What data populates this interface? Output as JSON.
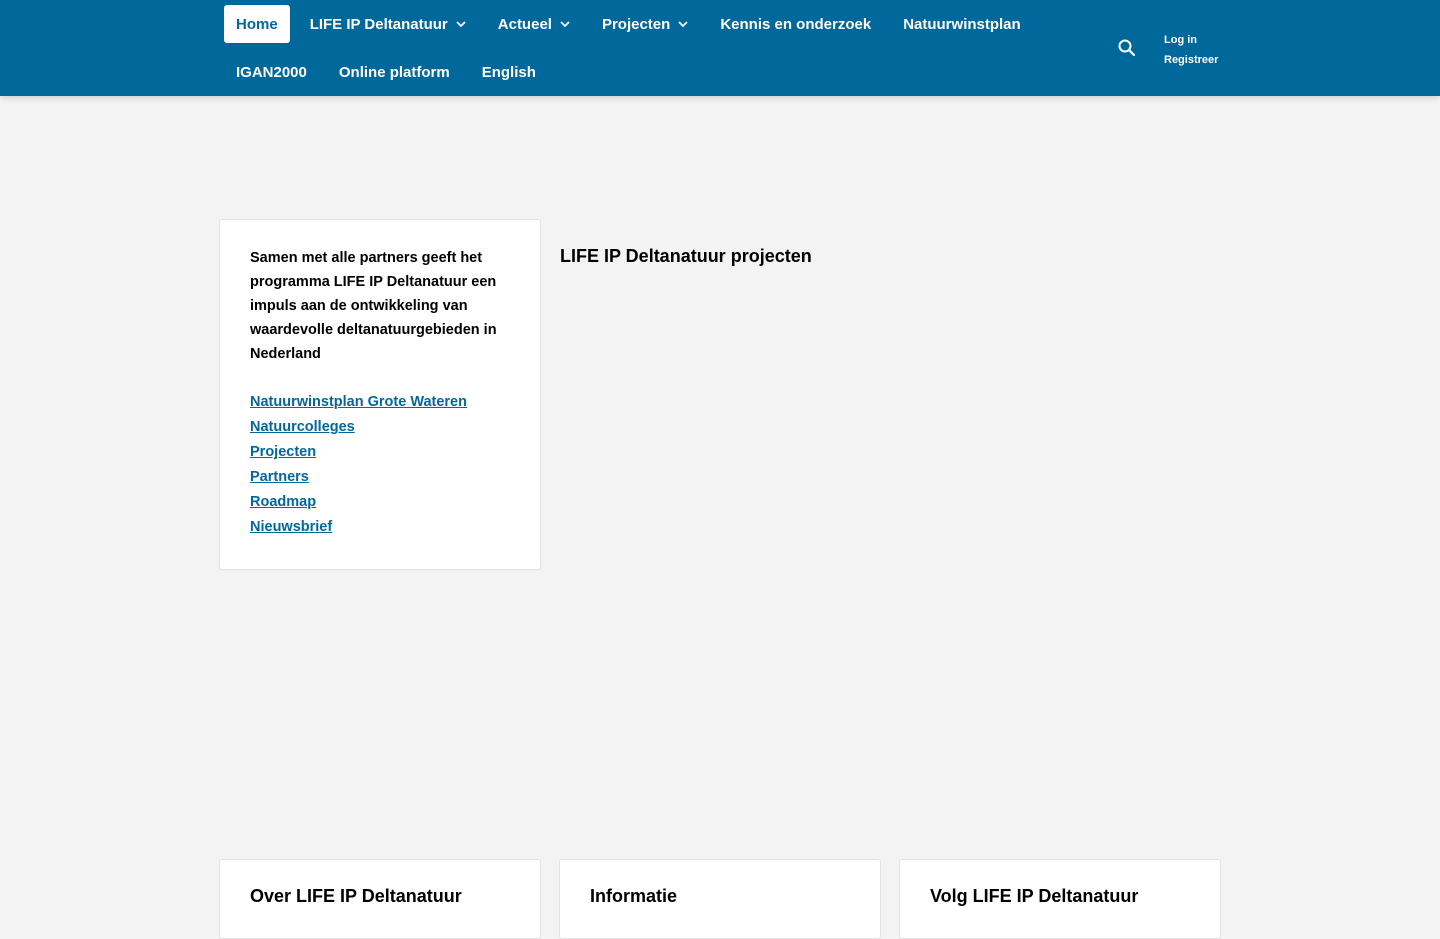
{
  "nav": {
    "row1": [
      {
        "label": "Home",
        "active": true,
        "dropdown": false
      },
      {
        "label": "LIFE IP Deltanatuur",
        "active": false,
        "dropdown": true
      },
      {
        "label": "Actueel",
        "active": false,
        "dropdown": true
      },
      {
        "label": "Projecten",
        "active": false,
        "dropdown": true
      },
      {
        "label": "Kennis en onderzoek",
        "active": false,
        "dropdown": false
      },
      {
        "label": "Natuurwinstplan",
        "active": false,
        "dropdown": false
      }
    ],
    "row2": [
      {
        "label": "IGAN2000"
      },
      {
        "label": "Online platform"
      },
      {
        "label": "English"
      }
    ],
    "search_icon": "search-icon",
    "login": "Log in",
    "register": "Registreer"
  },
  "intro": {
    "text": "Samen met alle partners geeft het programma LIFE IP Deltanatuur een impuls aan de ontwikkeling van waardevolle deltanatuurgebieden in Nederland",
    "links": [
      "Natuurwinstplan Grote Wateren",
      "Natuurcolleges",
      "Projecten",
      "Partners",
      "Roadmap",
      "Nieuwsbrief"
    ]
  },
  "main": {
    "title": "LIFE IP Deltanatuur projecten"
  },
  "footer": {
    "cards": [
      {
        "title": "Over LIFE IP Deltanatuur"
      },
      {
        "title": "Informatie"
      },
      {
        "title": "Volg LIFE IP Deltanatuur"
      }
    ]
  },
  "colors": {
    "brand": "#01689b",
    "background": "#f3f3f3"
  }
}
